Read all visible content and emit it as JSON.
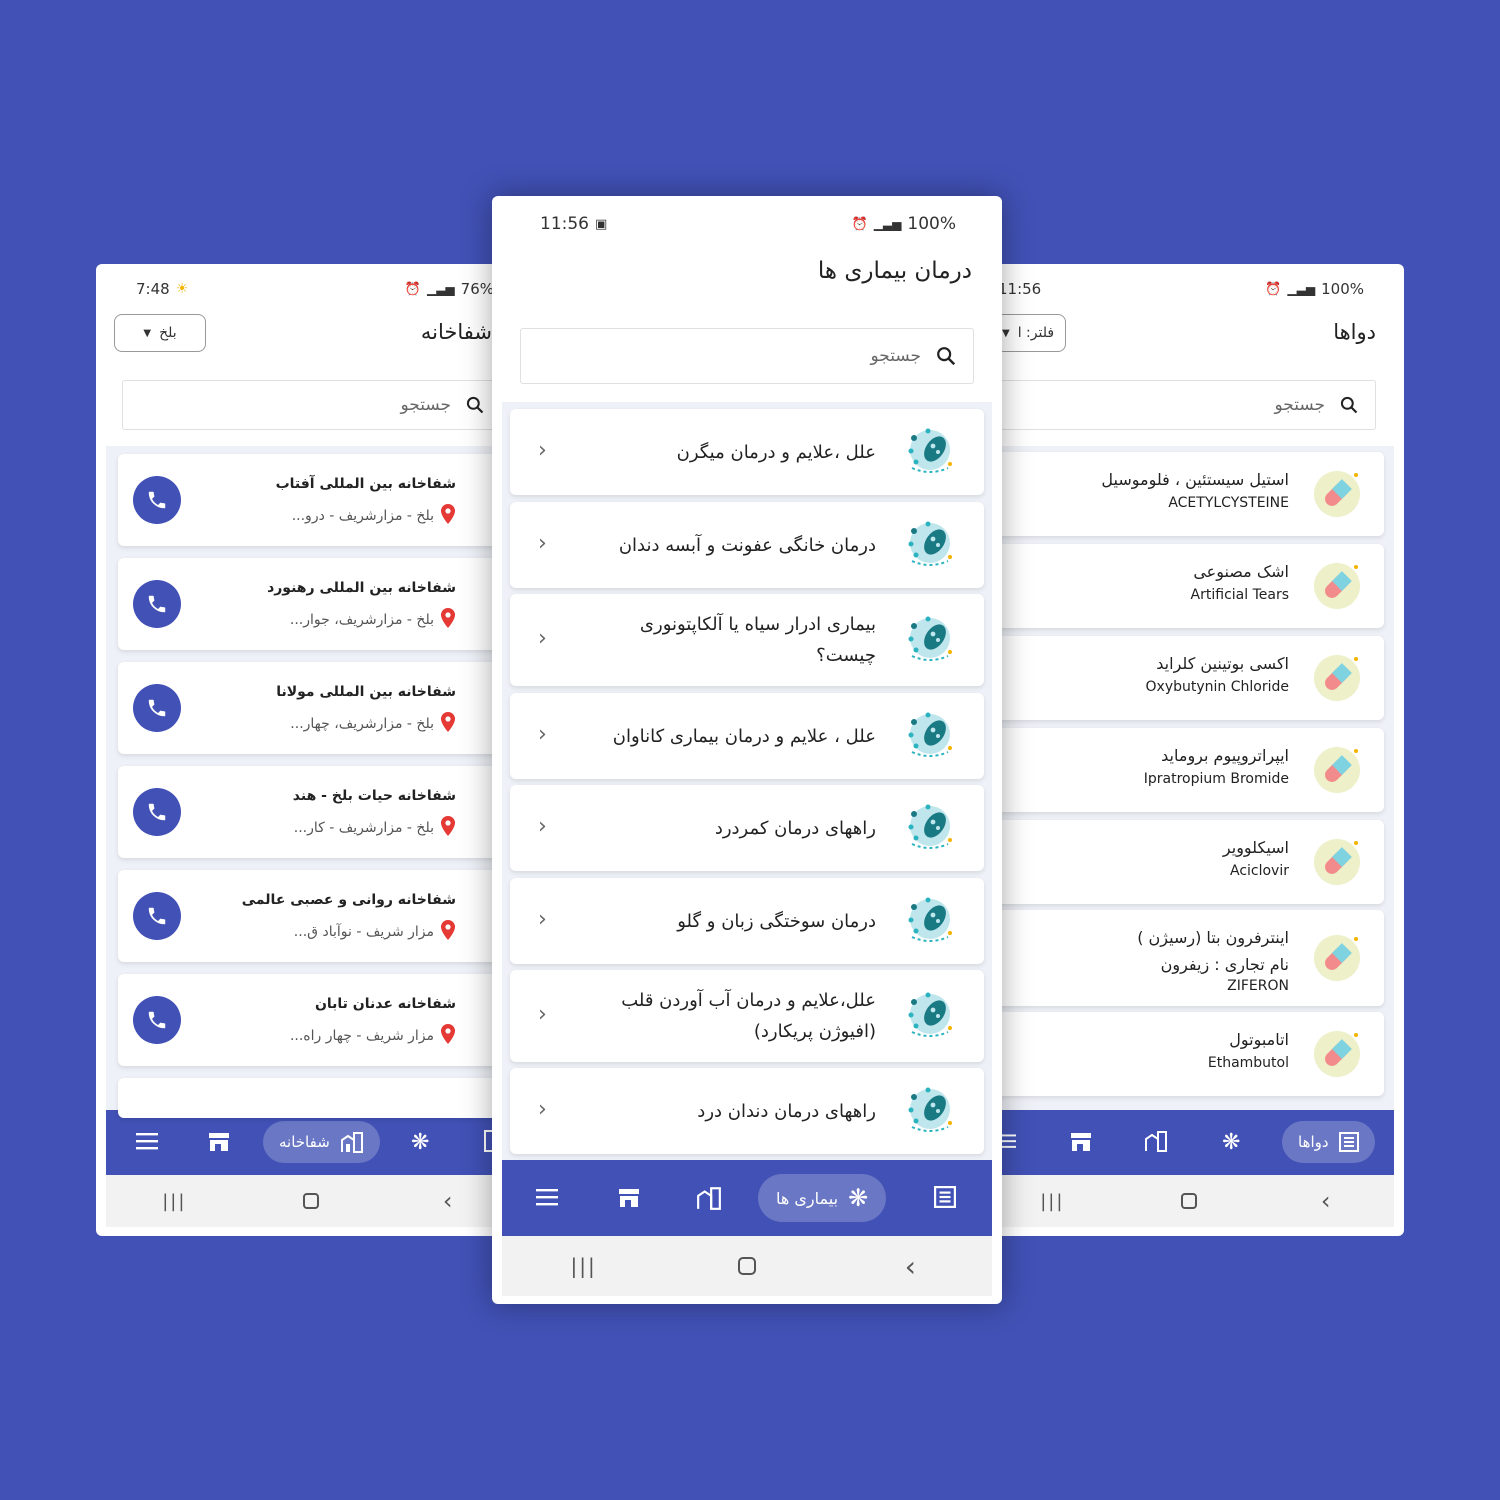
{
  "background_color": "#4151b5",
  "left_phone": {
    "status_time": "7:48",
    "status_right": "76%",
    "title": "شفاخانه",
    "dropdown": "بلخ",
    "search_placeholder": "جستجو",
    "items": [
      {
        "name": "شفاخانه بین المللی آفتاب",
        "address": "بلخ - مزارشریف - درو..."
      },
      {
        "name": "شفاخانه بین المللی رهنورد",
        "address": "بلخ - مزارشریف، جوار..."
      },
      {
        "name": "شفاخانه بین المللی مولانا",
        "address": "بلخ - مزارشریف، چهار..."
      },
      {
        "name": "شفاخانه حیات بلخ - هند",
        "address": "بلخ - مزارشریف - کار..."
      },
      {
        "name": "شفاخانه روانی و عصبی عالمی",
        "address": "مزار شریف - نوآباد ق..."
      },
      {
        "name": "شفاخانه عدنان تابان",
        "address": "مزار شریف - چهار راه..."
      }
    ],
    "nav_active_label": "شفاخانه"
  },
  "center_phone": {
    "status_time": "11:56",
    "status_right": "100%",
    "title": "درمان بیماری ها",
    "search_placeholder": "جستجو",
    "items": [
      {
        "line1": "علل ،علایم و درمان میگرن",
        "line2": ""
      },
      {
        "line1": "درمان خانگی عفونت و آبسه دندان",
        "line2": ""
      },
      {
        "line1": "بیماری ادرار سیاه یا آلکاپتونوری",
        "line2": "چیست؟"
      },
      {
        "line1": "علل ، علایم و درمان بیماری کاناوان",
        "line2": ""
      },
      {
        "line1": "راههای درمان کمردرد",
        "line2": ""
      },
      {
        "line1": "درمان سوختگی زبان و گلو",
        "line2": ""
      },
      {
        "line1": "علل،علایم و درمان آب آوردن قلب",
        "line2": "(افیوژن پریکارد)"
      },
      {
        "line1": "راههای درمان دندان درد",
        "line2": ""
      }
    ],
    "nav_active_label": "بیماری ها"
  },
  "right_phone": {
    "status_time": "11:56",
    "status_right": "100%",
    "title": "دواها",
    "dropdown": "فلتر: ا",
    "search_placeholder": "جستجو",
    "items": [
      {
        "fa": "استیل سیستئین ، فلوموسیل",
        "fa2": "",
        "en": "ACETYLCYSTEINE"
      },
      {
        "fa": "اشک مصنوعی",
        "fa2": "",
        "en": "Artificial Tears"
      },
      {
        "fa": "اکسی بوتینین کلراید",
        "fa2": "",
        "en": "Oxybutynin Chloride"
      },
      {
        "fa": "ایپراتروپیوم بروماید",
        "fa2": "",
        "en": "Ipratropium Bromide"
      },
      {
        "fa": "اسیکلوویر",
        "fa2": "",
        "en": "Aciclovir"
      },
      {
        "fa": "اینترفرون بتا (رسیژن )",
        "fa2": "نام تجاری : زیفرون",
        "en": "ZIFERON"
      },
      {
        "fa": "اتامبوتول",
        "fa2": "",
        "en": "Ethambutol"
      }
    ],
    "nav_active_label": "دواها"
  }
}
